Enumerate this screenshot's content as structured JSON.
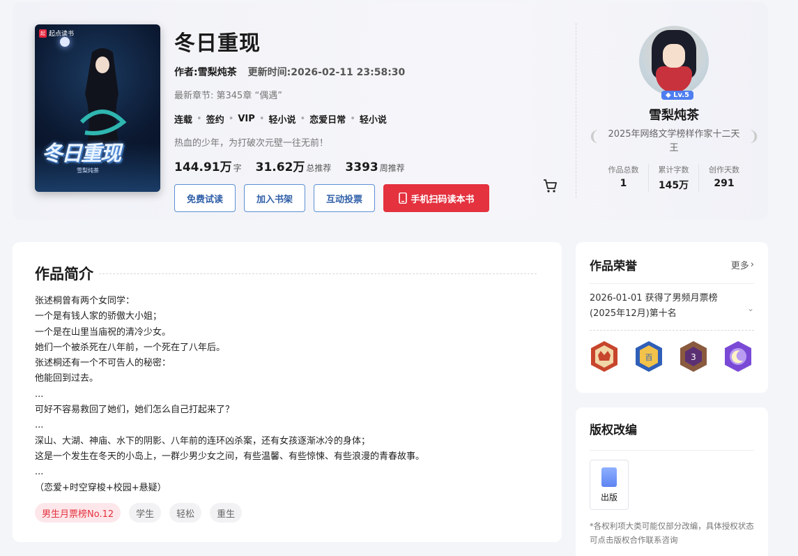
{
  "book": {
    "cover_publisher": "起点读书",
    "cover_title": "冬日重现",
    "cover_author": "雪梨炖茶",
    "title": "冬日重现",
    "author_line": "作者:雪梨炖茶",
    "update_line": "更新时间:2026-02-11 23:58:30",
    "latest_chapter": "最新章节: 第345章 “偶遇”",
    "tags": [
      "连载",
      "签约",
      "VIP",
      "轻小说",
      "恋爱日常",
      "轻小说"
    ],
    "slogan": "热血的少年，为打破次元壁一往无前！",
    "stats": [
      {
        "num": "144.91万",
        "unit": "字"
      },
      {
        "num": "31.62万",
        "unit": "总推荐"
      },
      {
        "num": "3393",
        "unit": "周推荐"
      }
    ],
    "buttons": {
      "trial": "免费试读",
      "shelf": "加入书架",
      "vote": "互动投票",
      "scan": "手机扫码读本书"
    }
  },
  "author": {
    "level": "Lv.5",
    "name": "雪梨炖茶",
    "honor": "2025年网络文学榜样作家十二天王",
    "stats": [
      {
        "label": "作品总数",
        "value": "1"
      },
      {
        "label": "累计字数",
        "value": "145万"
      },
      {
        "label": "创作天数",
        "value": "291"
      }
    ]
  },
  "intro": {
    "heading": "作品简介",
    "lines": [
      "张述桐曾有两个女同学：",
      "一个是有钱人家的骄傲大小姐；",
      "一个是在山里当庙祝的清冷少女。",
      "她们一个被杀死在八年前，一个死在了八年后。",
      "张述桐还有一个不可告人的秘密：",
      "他能回到过去。",
      "...",
      "可好不容易救回了她们，她们怎么自己打起来了？",
      "...",
      "深山、大湖、神庙、水下的阴影、八年前的连环凶杀案，还有女孩逐渐冰冷的身体；",
      "这是一个发生在冬天的小岛上，一群少男少女之间，有些温馨、有些惊悚、有些浪漫的青春故事。",
      "...",
      "（恋爱+时空穿梭+校园+悬疑）"
    ],
    "chips": [
      "男生月票榜No.12",
      "学生",
      "轻松",
      "重生"
    ]
  },
  "honors": {
    "heading": "作品荣誉",
    "more": "更多",
    "entry": "2026-01-01 获得了男频月票榜(2025年12月)第十名",
    "medal_names": [
      "bronze-crown-medal-icon",
      "blue-hundred-alliance-medal-icon",
      "number-three-medal-icon",
      "purple-moon-medal-icon"
    ],
    "medal_colors": [
      "#c7452c",
      "#2f5fb8",
      "#6a3a2a",
      "#7a4ad6"
    ]
  },
  "copyright": {
    "heading": "版权改编",
    "item": "出版",
    "note": "*各权利项大类可能仅部分改编，具体授权状态可点击版权合作联系咨询"
  }
}
